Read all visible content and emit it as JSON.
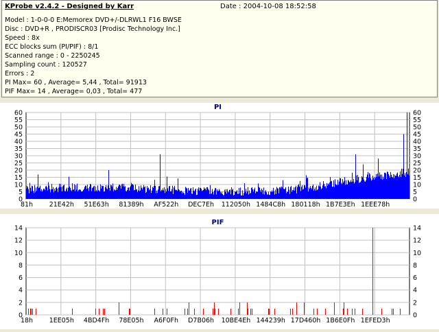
{
  "info": {
    "title": "KProbe v2.4.2 - Designed by Karr",
    "date": "Date : 2004-10-08 18:52:58",
    "lines": [
      "Model : 1-0-0-0 E:Memorex DVD+/-DLRWL1 F16 BWSE",
      "Disc : DVD+R , PRODISCR03 [Prodisc Technology Inc.]",
      "Speed : 8x",
      "ECC blocks sum (PI/PIF) : 8/1",
      "Scanned range : 0 - 2250245",
      "Sampling count : 120527",
      "Errors : 2",
      "PI Max= 60 , Average= 5,44 , Total= 91913",
      "PIF Max= 14 , Average= 0,03 , Total= 477"
    ]
  },
  "chart_data": [
    {
      "type": "bar",
      "title": "PI",
      "ylim": [
        0,
        60
      ],
      "yticks": [
        0,
        5,
        10,
        15,
        20,
        25,
        30,
        35,
        40,
        45,
        50,
        55,
        60
      ],
      "xticks": [
        "81h",
        "21E42h",
        "51E63h",
        "81389h",
        "AF522h",
        "DEC7Eh",
        "112050h",
        "1484C8h",
        "180118h",
        "1B7E3Eh",
        "1EEE78h"
      ],
      "grid": true,
      "color": "#0000ff",
      "baseline": 6,
      "spikes": [
        {
          "x": 0.03,
          "y": 17
        },
        {
          "x": 0.215,
          "y": 20
        },
        {
          "x": 0.35,
          "y": 31
        },
        {
          "x": 0.86,
          "y": 31
        },
        {
          "x": 0.88,
          "y": 24
        },
        {
          "x": 0.92,
          "y": 28
        },
        {
          "x": 0.985,
          "y": 45
        },
        {
          "x": 0.995,
          "y": 60
        }
      ]
    },
    {
      "type": "bar",
      "title": "PIF",
      "ylim": [
        0,
        14
      ],
      "yticks": [
        0,
        2,
        4,
        6,
        8,
        10,
        12,
        14
      ],
      "xticks": [
        "18h",
        "1EE05h",
        "4BD4Fh",
        "78E05h",
        "A6F0Fh",
        "D7B06h",
        "10BE4Eh",
        "144239h",
        "17D460h",
        "1B6E0Fh",
        "1EFED3h"
      ],
      "grid": true,
      "color": "#ff0000",
      "spikes": [
        {
          "x": 0.905,
          "y": 14
        }
      ]
    }
  ]
}
